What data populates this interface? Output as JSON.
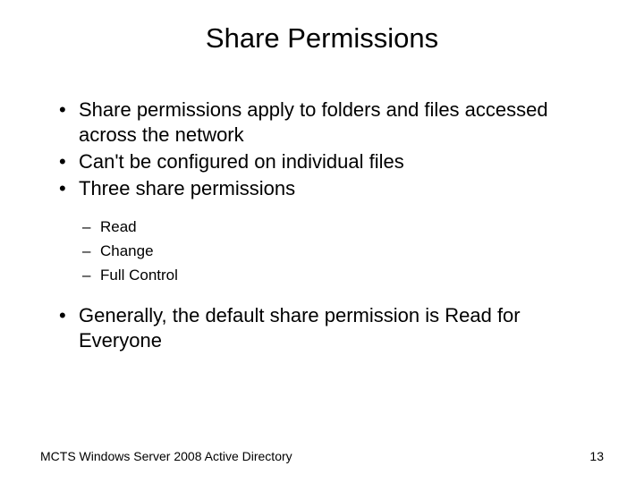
{
  "title": "Share Permissions",
  "bullets": {
    "b1": "Share permissions apply to folders and files accessed across the network",
    "b2": "Can't be configured on individual files",
    "b3": "Three share permissions",
    "b4": "Generally, the default share permission is Read for Everyone"
  },
  "sub": {
    "s1": "Read",
    "s2": "Change",
    "s3": "Full Control"
  },
  "footer": {
    "left": "MCTS Windows Server 2008 Active Directory",
    "right": "13"
  }
}
